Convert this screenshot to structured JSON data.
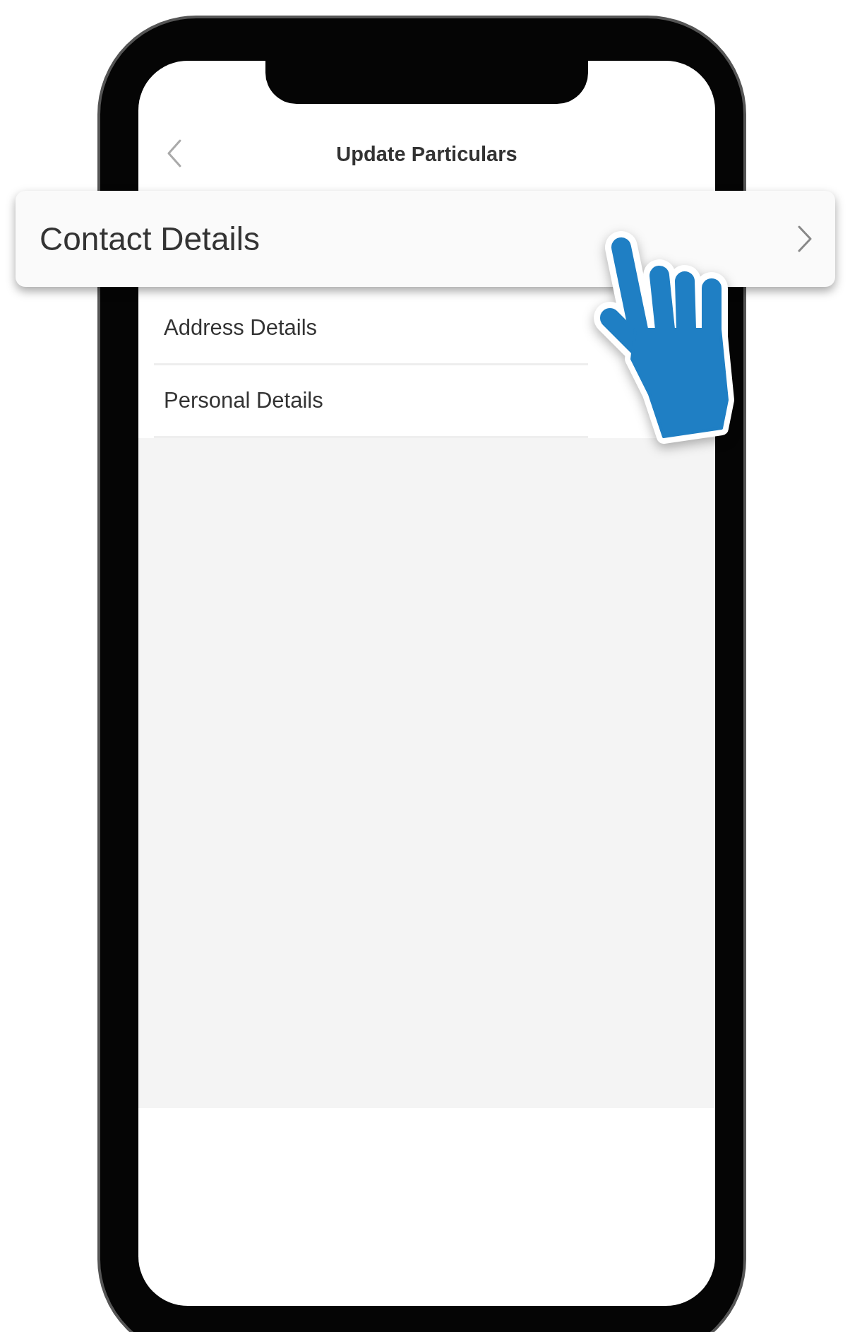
{
  "screen": {
    "title": "Update Particulars",
    "items": [
      {
        "label": "Address Details"
      },
      {
        "label": "Personal Details"
      }
    ]
  },
  "callout": {
    "label": "Contact Details"
  }
}
